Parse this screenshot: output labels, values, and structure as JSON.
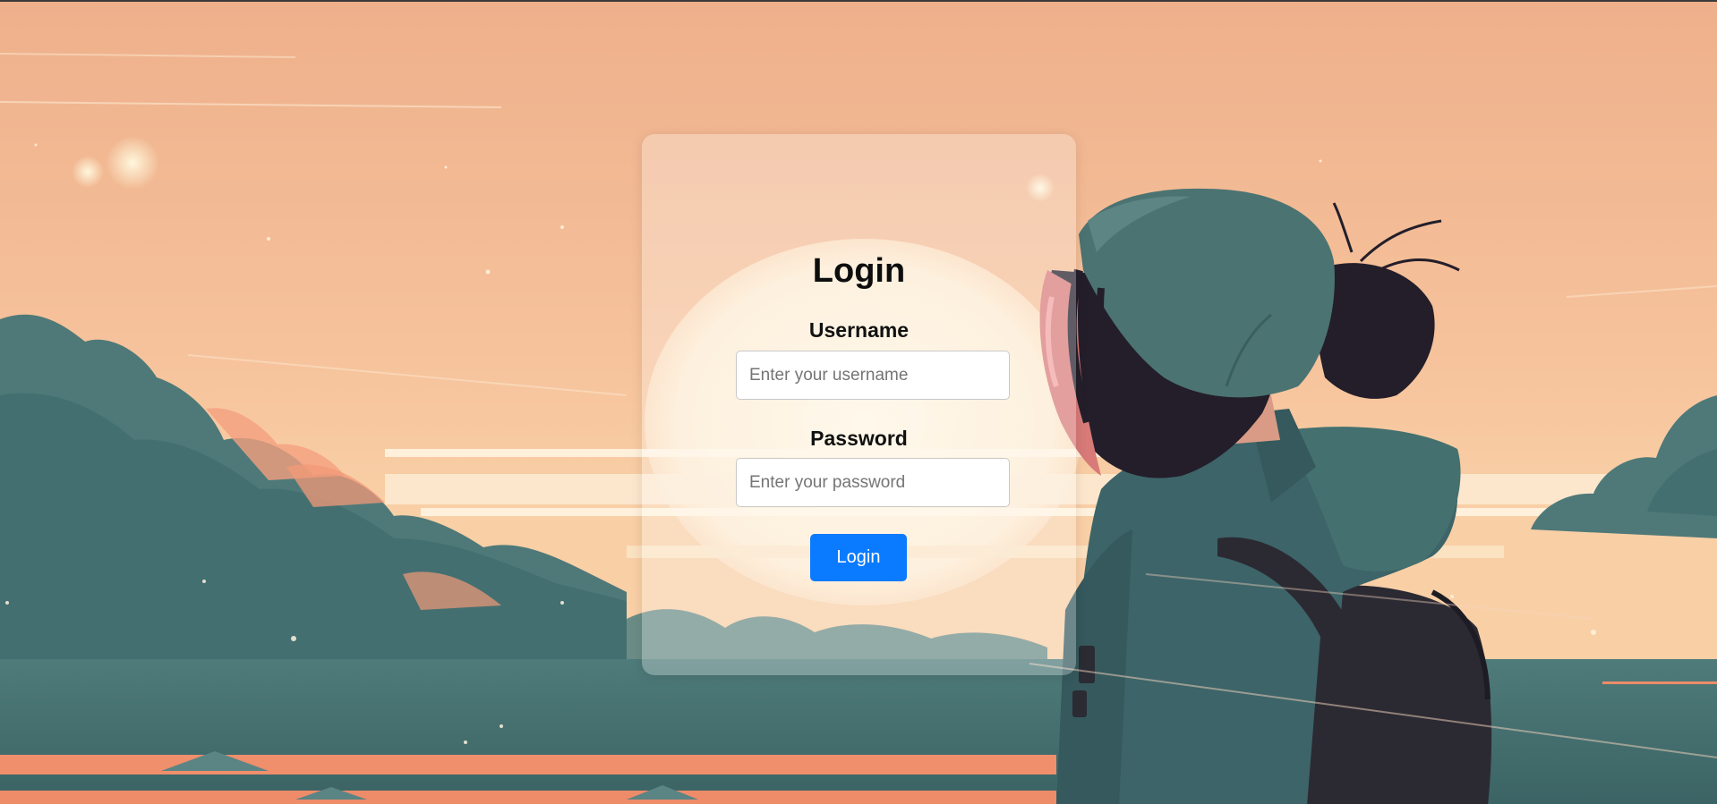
{
  "login": {
    "title": "Login",
    "username_label": "Username",
    "username_placeholder": "Enter your username",
    "password_label": "Password",
    "password_placeholder": "Enter your password",
    "button_label": "Login"
  },
  "colors": {
    "sky_top": "#efb38e",
    "sky_bottom": "#f7c79f",
    "cloud_teal": "#4d7878",
    "cloud_dark": "#2f5457",
    "sunset_orange": "#f08c6a",
    "button_blue": "#0a7bff",
    "jacket_teal": "#3d6468",
    "hair_dark": "#1f1c26"
  },
  "background": {
    "description_icon": "anime-sunset-background"
  }
}
